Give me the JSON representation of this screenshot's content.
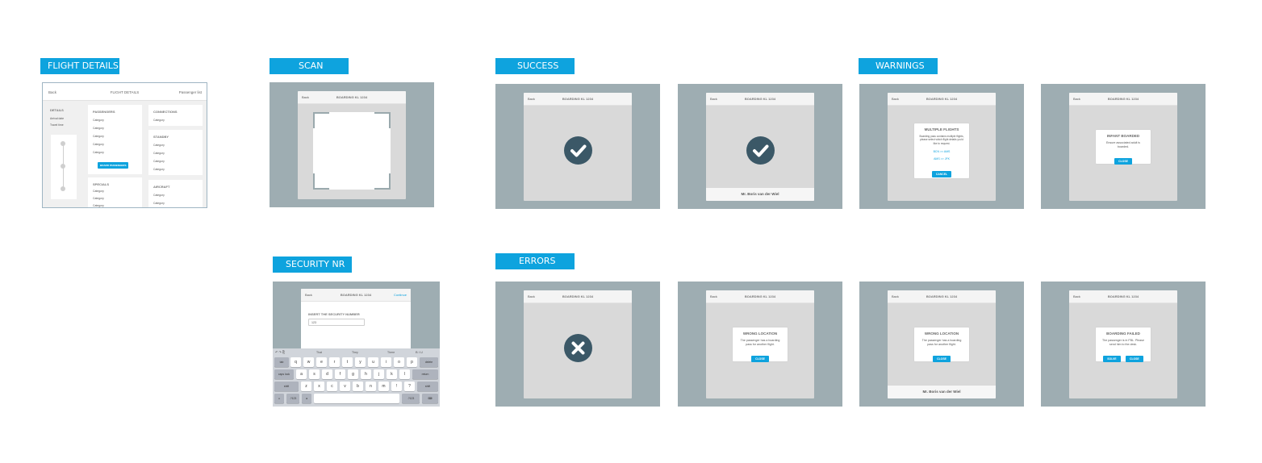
{
  "sections": {
    "flight_details": "FLIGHT DETAILS",
    "scan": "SCAN",
    "success": "SUCCESS",
    "warnings": "WARNINGS",
    "security_nr": "SECURITY NR",
    "errors": "ERRORS"
  },
  "flight_details_screen": {
    "back": "Back",
    "title": "FLIGHT DETAILS",
    "passenger_list": "Passenger list",
    "details": {
      "heading": "DETAILS",
      "arrival": "Arrival date",
      "travel": "Travel time"
    },
    "passengers": {
      "heading": "PASSENGERS",
      "rows": [
        "Category",
        "Category",
        "Category",
        "Category",
        "Category"
      ],
      "button": "BOARD PASSENGERS"
    },
    "specials": {
      "heading": "SPECIALS",
      "rows": [
        "Category",
        "Category",
        "Category"
      ]
    },
    "connections": {
      "heading": "CONNECTIONS",
      "rows": [
        "Category"
      ]
    },
    "standby": {
      "heading": "STANDBY",
      "rows": [
        "Category",
        "Category",
        "Category",
        "Category"
      ]
    },
    "aircraft": {
      "heading": "AIRCRAFT",
      "rows": [
        "Category",
        "Category"
      ]
    }
  },
  "device": {
    "back": "Back",
    "title": "BOARDING KL 1234",
    "continue": "Continue"
  },
  "passenger_name": "Mr. Boris van der Wiel",
  "security": {
    "label": "INSERT THE SECURITY NUMBER",
    "value": "123"
  },
  "keyboard": {
    "suggestions": [
      "That",
      "They",
      "There"
    ],
    "row1": [
      "q",
      "w",
      "e",
      "r",
      "t",
      "y",
      "u",
      "i",
      "o",
      "p"
    ],
    "row2": [
      "a",
      "s",
      "d",
      "f",
      "g",
      "h",
      "j",
      "k",
      "l"
    ],
    "row3": [
      "z",
      "x",
      "c",
      "v",
      "b",
      "n",
      "m",
      "!",
      "?"
    ],
    "tab": "tab",
    "delete": "delete",
    "caps": "caps lock",
    "return": "return",
    "shift": "shift",
    "numbers": ".?123"
  },
  "warnings": {
    "multiple": {
      "title": "MULTIPLE FLIGHTS",
      "text": "Boarding pass contains multiple flights, please select which flight details you'd like to request.",
      "option1": "BCN >> AMS",
      "option2": "AMS >> JFK",
      "button": "CANCEL"
    },
    "infant": {
      "title": "INFANT BOARDED",
      "text": "Ensure associated adult is boarded.",
      "button": "CLOSE"
    }
  },
  "errors": {
    "wrong_location": {
      "title": "WRONG LOCATION",
      "text": "The passenger has a boarding pass for another flight.",
      "button": "CLOSE"
    },
    "boarding_failed": {
      "title": "BOARDING FAILED",
      "text": "The passenger is in FBL. Please send him to the desk.",
      "button_solve": "SOLVE",
      "button_close": "CLOSE"
    }
  },
  "colors": {
    "accent": "#0ea3de",
    "board_bg": "#9eadb2",
    "icon_dark": "#3b5867"
  }
}
